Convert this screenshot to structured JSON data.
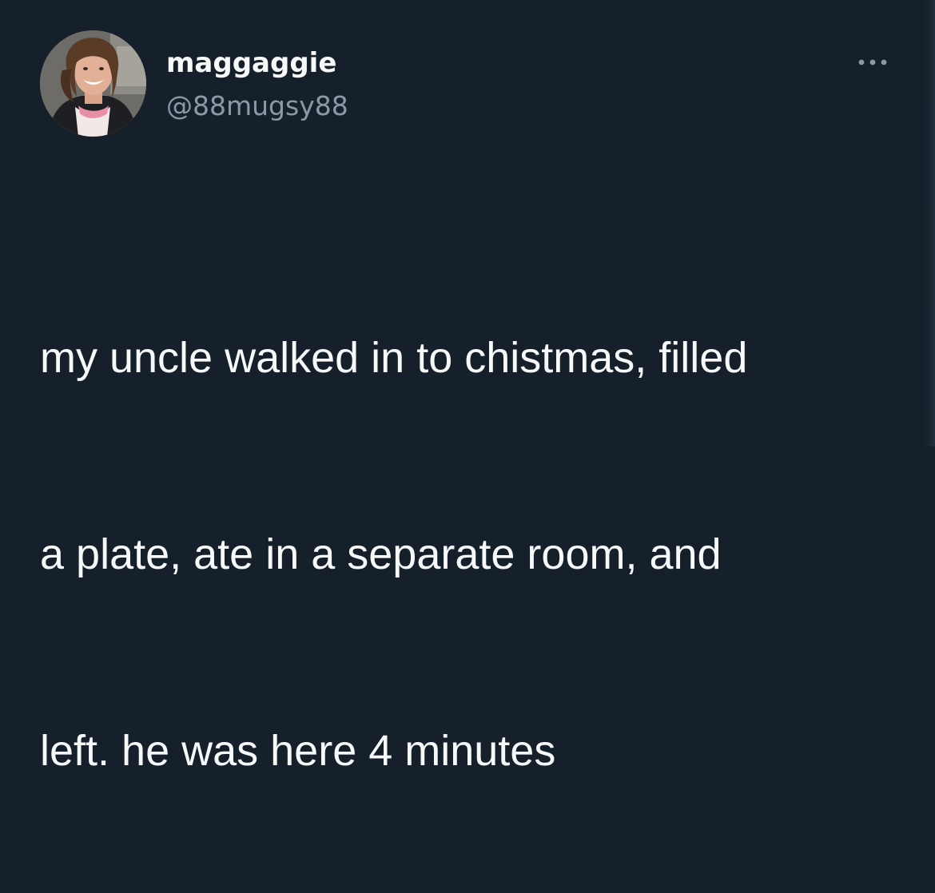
{
  "tweet": {
    "author": {
      "display_name": "maggaggie",
      "handle": "@88mugsy88"
    },
    "more_icon": "ellipsis-icon",
    "text_lines": [
      "my uncle walked in to chistmas, filled",
      "a plate, ate in a separate room, and",
      "left. he was here 4 minutes"
    ]
  },
  "colors": {
    "background": "#15202b",
    "primary_text": "#f7f9f9",
    "secondary_text": "#8b98a5"
  }
}
